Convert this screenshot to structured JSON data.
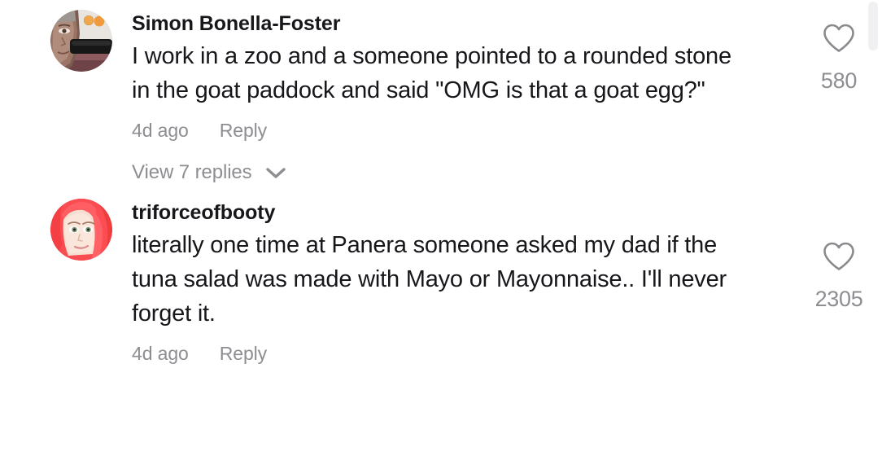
{
  "comments": [
    {
      "username": "Simon Bonella-Foster",
      "text": "I work in a zoo and a someone pointed to a rounded stone in the goat paddock and said \"OMG is that a goat egg?\"",
      "time": "4d ago",
      "reply_label": "Reply",
      "view_replies_label": "View 7 replies",
      "like_count": "580",
      "like_icon": "heart-outline-icon",
      "expand_icon": "chevron-down-icon"
    },
    {
      "username": "triforceofbooty",
      "text": "literally one time at Panera someone asked my dad if the tuna salad was made with Mayo or Mayonnaise.. I'll never forget it.",
      "time": "4d ago",
      "reply_label": "Reply",
      "like_count": "2305",
      "like_icon": "heart-outline-icon"
    }
  ],
  "colors": {
    "background": "#ffffff",
    "primary_text": "#17161a",
    "secondary_text": "#8d8d92",
    "icon_gray": "#8a8a8e",
    "scrollbar_thumb": "#f0f0f2"
  },
  "scrollbar": {
    "name": "vertical-scrollbar"
  }
}
